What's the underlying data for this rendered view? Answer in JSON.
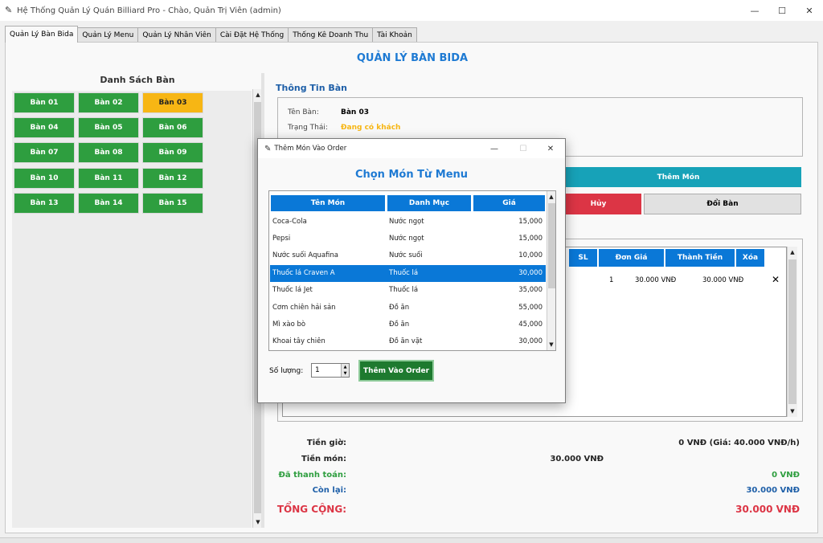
{
  "window": {
    "title": "Hệ Thống Quản Lý Quán Billiard Pro - Chào, Quản Trị Viên (admin)",
    "minimize": "—",
    "maximize": "☐",
    "close": "✕"
  },
  "tabs": [
    {
      "label": "Quản Lý Bàn Bida",
      "active": true
    },
    {
      "label": "Quản Lý Menu"
    },
    {
      "label": "Quản Lý Nhân Viên"
    },
    {
      "label": "Cài Đặt Hệ Thống"
    },
    {
      "label": "Thống Kê Doanh Thu"
    },
    {
      "label": "Tài Khoản"
    }
  ],
  "page_title": "QUẢN LÝ BÀN BIDA",
  "left": {
    "title": "Danh Sách Bàn",
    "tables": [
      "Bàn 01",
      "Bàn 02",
      "Bàn 03",
      "Bàn 04",
      "Bàn 05",
      "Bàn 06",
      "Bàn 07",
      "Bàn 08",
      "Bàn 09",
      "Bàn 10",
      "Bàn 11",
      "Bàn 12",
      "Bàn 13",
      "Bàn 14",
      "Bàn 15"
    ],
    "busy_table": "Bàn 03",
    "colors": {
      "free": "#2e9e3f",
      "busy": "#f7b614"
    }
  },
  "info": {
    "title": "Thông Tin Bàn",
    "name_label": "Tên Bàn:",
    "name_value": "Bàn 03",
    "status_label": "Trạng Thái:",
    "status_value": "Đang có khách",
    "status_color": "#f7b614"
  },
  "actions": {
    "add_item": "Thêm Món",
    "cancel": "Hủy",
    "swap_table": "Đổi Bàn"
  },
  "order": {
    "headers": [
      "SL",
      "Đơn Giá",
      "Thành Tiền",
      "Xóa"
    ],
    "rows": [
      {
        "qty": "1",
        "unit_price": "30.000 VNĐ",
        "total": "30.000 VNĐ",
        "delete": "✕"
      }
    ]
  },
  "summary": {
    "time_label": "Tiền giờ:",
    "time_value": "0 VNĐ (Giá: 40.000 VNĐ/h)",
    "items_label": "Tiền món:",
    "items_value": "30.000 VNĐ",
    "paid_label": "Đã thanh toán:",
    "paid_value": "0 VNĐ",
    "remaining_label": "Còn lại:",
    "remaining_value": "30.000 VNĐ",
    "grand_label": "TỔNG CỘNG:",
    "grand_value": "30.000 VNĐ"
  },
  "dialog": {
    "title": "Thêm Món Vào Order",
    "minimize": "—",
    "maximize": "☐",
    "close": "✕",
    "heading": "Chọn Món Từ Menu",
    "headers": [
      "Tên Món",
      "Danh Mục",
      "Giá"
    ],
    "items": [
      {
        "name": "Coca-Cola",
        "category": "Nước ngọt",
        "price": "15,000"
      },
      {
        "name": "Pepsi",
        "category": "Nước ngọt",
        "price": "15,000"
      },
      {
        "name": "Nước suối Aquafina",
        "category": "Nước suối",
        "price": "10,000"
      },
      {
        "name": "Thuốc lá Craven A",
        "category": "Thuốc lá",
        "price": "30,000",
        "selected": true
      },
      {
        "name": "Thuốc lá Jet",
        "category": "Thuốc lá",
        "price": "35,000"
      },
      {
        "name": "Cơm chiên hải sản",
        "category": "Đồ ăn",
        "price": "55,000"
      },
      {
        "name": "Mì xào bò",
        "category": "Đồ ăn",
        "price": "45,000"
      },
      {
        "name": "Khoai tây chiên",
        "category": "Đồ ăn vặt",
        "price": "30,000"
      }
    ],
    "qty_label": "Số lượng:",
    "qty_value": "1",
    "add_button": "Thêm Vào Order"
  }
}
